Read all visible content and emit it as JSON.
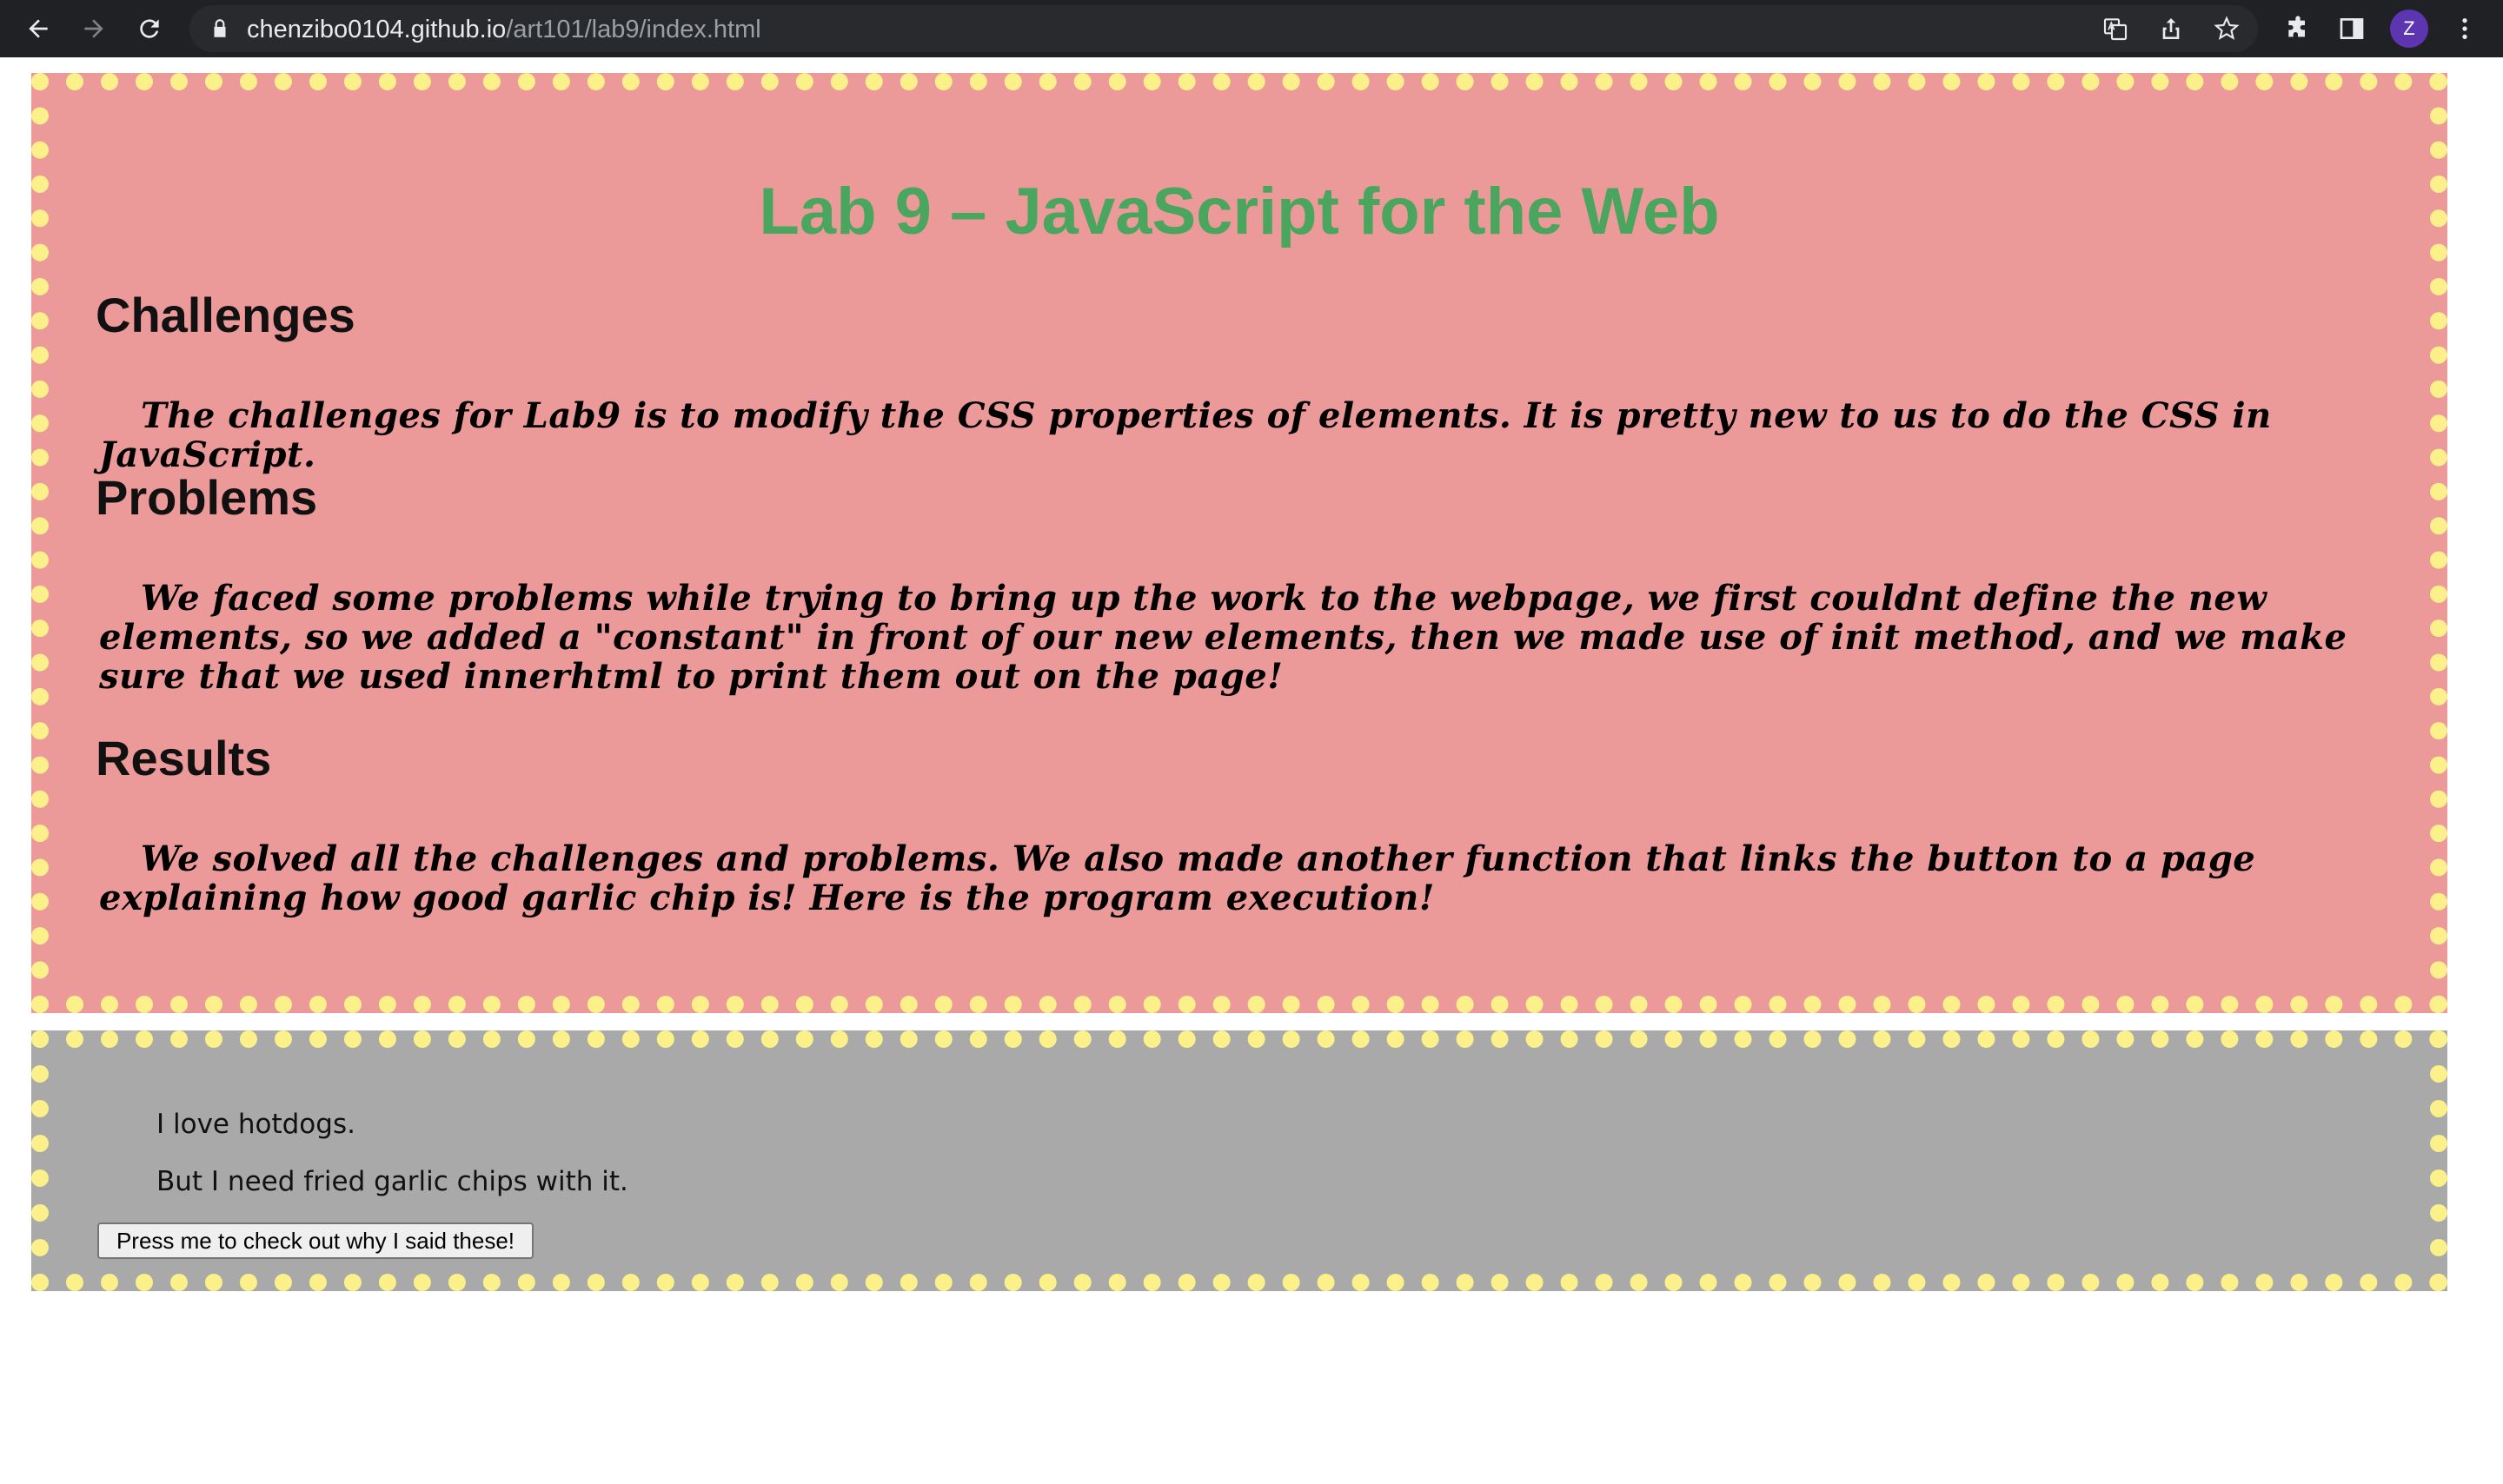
{
  "browser": {
    "url_host": "chenzibo0104.github.io",
    "url_path": "/art101/lab9/index.html",
    "profile_initial": "Z"
  },
  "page": {
    "title": "Lab 9 – JavaScript for the Web",
    "sections": [
      {
        "heading": "Challenges",
        "text": "The challenges for Lab9 is to modify the CSS properties of elements. It is pretty new to us to do the CSS in JavaScript."
      },
      {
        "heading": "Problems",
        "text": "We faced some problems while trying to bring up the work to the webpage, we first couldnt define the new elements, so we added a \"constant\" in front of our new elements, then we made use of init method, and we make sure that we used innerhtml to print them out on the page!"
      },
      {
        "heading": "Results",
        "text": "We solved all the challenges and problems. We also made another function that links the button to a page explaining how good garlic chip is! Here is the program execution!"
      }
    ],
    "output": {
      "line1": "I love hotdogs.",
      "line2": "But I need fried garlic chips with it.",
      "button_label": "Press me to check out why I said these!"
    }
  },
  "colors": {
    "pink_bg": "#ec9999",
    "gray_bg": "#a9a9a9",
    "dots": "#fbf08a",
    "title": "#4aa65e"
  }
}
